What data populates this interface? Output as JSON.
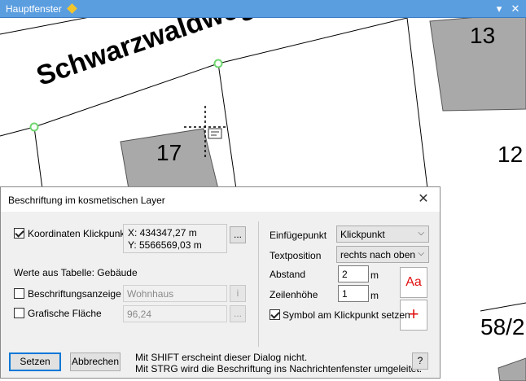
{
  "window": {
    "title": "Hauptfenster",
    "menu_icon": "chevron-down-icon",
    "close_icon": "close-icon"
  },
  "map": {
    "street_name": "Schwarzwaldweg",
    "house_numbers": {
      "left": "17",
      "top_right": "13",
      "right": "12",
      "bottom_right": "58/2"
    }
  },
  "dialog": {
    "title": "Beschriftung im kosmetischen Layer",
    "koordinaten_label": "Koordinaten Klickpunkt",
    "koordinaten_checked": true,
    "coord_x": "X:   434347,27 m",
    "coord_y": "Y: 5566569,03 m",
    "browse_label": "...",
    "werte_label": "Werte aus Tabelle: Gebäude",
    "beschriftungsanzeige_label": "Beschriftungsanzeige",
    "beschriftungsanzeige_checked": false,
    "beschriftungsanzeige_value": "Wohnhaus",
    "info_label": "i",
    "grafische_flaeche_label": "Grafische Fläche",
    "grafische_flaeche_checked": false,
    "grafische_flaeche_value": "96,24",
    "einfuegepunkt_label": "Einfügepunkt",
    "einfuegepunkt_value": "Klickpunkt",
    "textposition_label": "Textposition",
    "textposition_value": "rechts nach oben",
    "abstand_label": "Abstand",
    "abstand_value": "2",
    "abstand_unit": "m",
    "zeilenhoehe_label": "Zeilenhöhe",
    "zeilenhoehe_value": "1",
    "zeilenhoehe_unit": "m",
    "font_button_label": "Aa",
    "symbol_button_label": "+",
    "symbol_label": "Symbol am Klickpunkt setzen",
    "symbol_checked": true,
    "setzen_label": "Setzen",
    "abbrechen_label": "Abbrechen",
    "hint_line1": "Mit SHIFT erscheint dieser Dialog nicht.",
    "hint_line2": "Mit STRG wird die Beschriftung ins Nachrichtenfenster umgeleitet.",
    "help_label": "?"
  },
  "colors": {
    "titlebar": "#5b9ee0",
    "building": "#a9a9a9",
    "vertex": "#6fd66f",
    "accent_red": "#e01010"
  }
}
